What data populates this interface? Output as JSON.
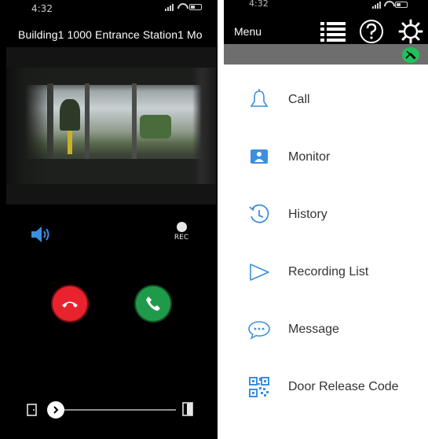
{
  "left_phone": {
    "status_time": "4:32",
    "station_title": "Building1  1000  Entrance Station1  Mo",
    "rec_label": "REC",
    "colors": {
      "hangup": "#e8232d",
      "answer": "#1f9a4a",
      "speaker": "#3b8fe0"
    }
  },
  "right_phone": {
    "status_time": "4:32",
    "header": {
      "title": "Menu"
    },
    "icons": [
      "list-icon",
      "help-icon",
      "settings-icon",
      "connection-badge-icon"
    ],
    "menu_items": [
      {
        "label": "Call",
        "icon": "bell-icon"
      },
      {
        "label": "Monitor",
        "icon": "monitor-icon"
      },
      {
        "label": "History",
        "icon": "history-icon"
      },
      {
        "label": "Recording List",
        "icon": "play-outline-icon"
      },
      {
        "label": "Message",
        "icon": "message-icon"
      },
      {
        "label": "Door Release Code",
        "icon": "qr-code-icon"
      }
    ],
    "colors": {
      "accent": "#3b8fe0",
      "badge": "#23c15b"
    }
  }
}
